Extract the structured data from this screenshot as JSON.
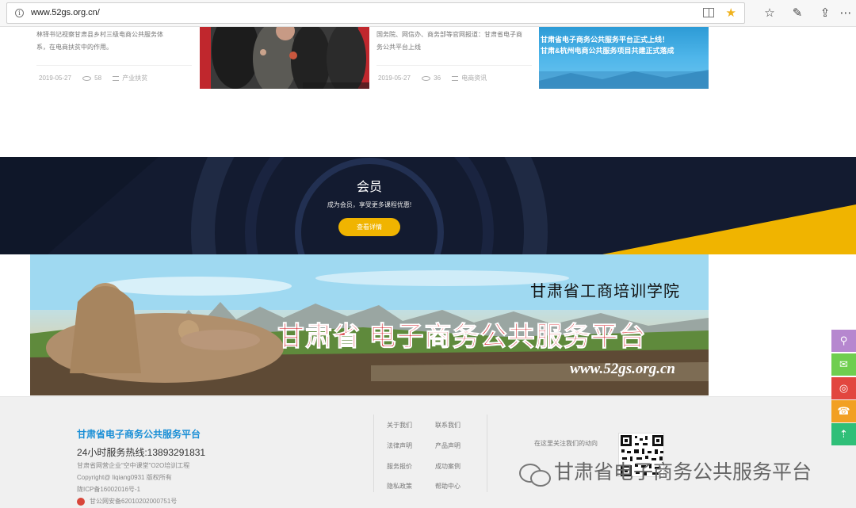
{
  "browser": {
    "url": "www.52gs.org.cn/",
    "info_icon": "i"
  },
  "news": [
    {
      "excerpt_lines": [
        "林铎书记视察甘肃县乡村三级电商公共服务体",
        "系，在电商扶贫中的作用。"
      ],
      "date": "2019-05-27",
      "views": "58",
      "category": "产业扶贫"
    },
    {
      "excerpt_lines": [
        "国务院、网信办、商务部等官网报道：甘肃省电子商",
        "务公共平台上线"
      ],
      "date": "2019-05-27",
      "views": "36",
      "category": "电商资讯"
    }
  ],
  "news_image2": {
    "line1": "甘肃省电子商务公共服务平台正式上线！",
    "line2": "甘肃&杭州电商公共服务项目共建正式落成"
  },
  "member": {
    "title": "会员",
    "subtitle": "成为会员，享受更多课程优惠!",
    "button": "查看详情"
  },
  "banner": {
    "line1": "甘肃省工商培训学院",
    "line2": "甘肃省 电子商务公共服务平台",
    "line3": "www.52gs.org.cn"
  },
  "footer": {
    "brand": "甘肃省电子商务公共服务平台",
    "hotline": "24小时服务热线:13893291831",
    "lines": [
      "甘肃省网营企业“空中课堂”O2O培训工程",
      "Copyright@ liqiang0931    版权所有",
      "陇ICP备16002016号-1",
      "甘公网安备62010202000751号"
    ],
    "links_col1": [
      "关于我们",
      "法律声明",
      "服务报价",
      "隐私政策"
    ],
    "links_col2": [
      "联系我们",
      "产品声明",
      "成功案例",
      "帮助中心"
    ],
    "follow_text": "在这里关注我们的动向"
  },
  "watermark": "甘肃省电子商务公共服务平台",
  "side_buttons": [
    {
      "icon": "qq-icon",
      "color": "#b687cf",
      "glyph": "⚲"
    },
    {
      "icon": "wechat-icon",
      "color": "#6fce4f",
      "glyph": "✉"
    },
    {
      "icon": "weibo-icon",
      "color": "#e2463f",
      "glyph": "◎"
    },
    {
      "icon": "phone-icon",
      "color": "#f2a023",
      "glyph": "☎"
    },
    {
      "icon": "back-to-top-icon",
      "color": "#2fbf78",
      "glyph": "⇡"
    }
  ],
  "colors": {
    "accent_yellow": "#f0b400",
    "brand_blue": "#1a8fd6",
    "banner_red": "#d2121b"
  }
}
